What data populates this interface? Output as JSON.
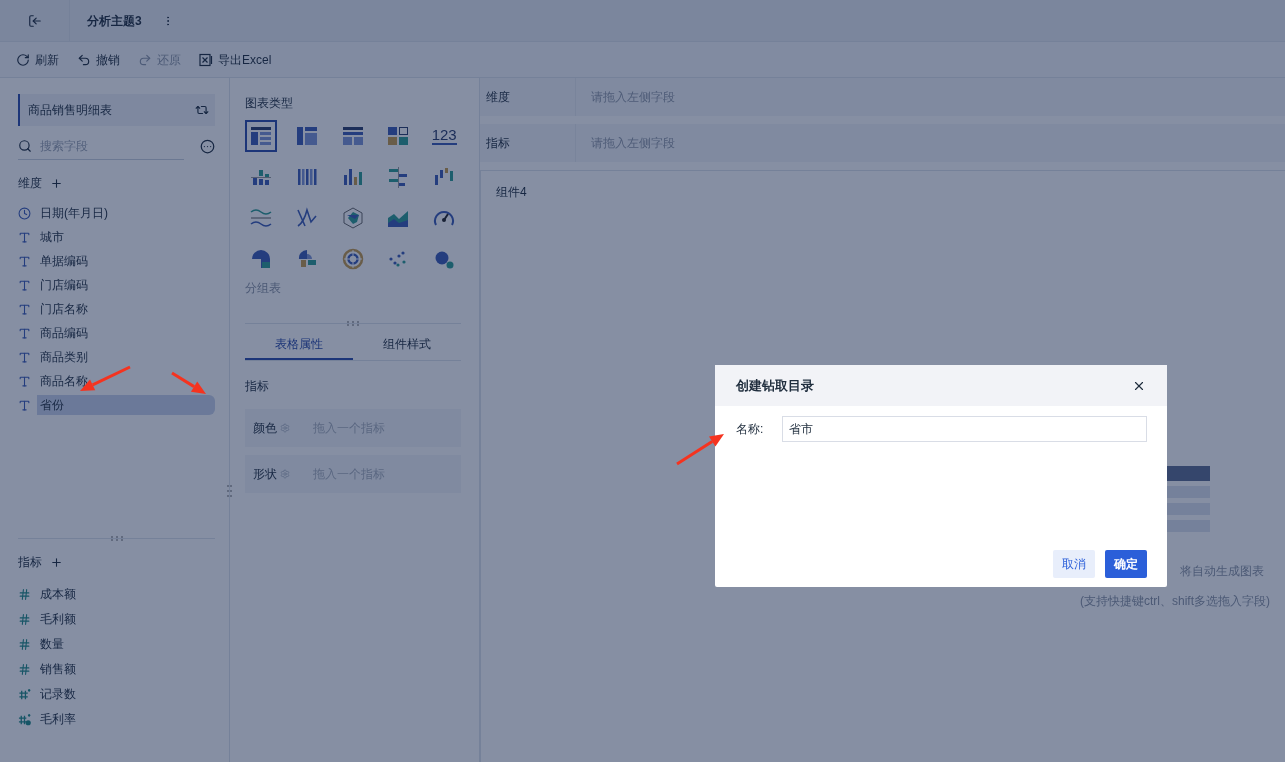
{
  "top_bar": {
    "title": "分析主题3"
  },
  "toolbar": [
    {
      "label": "刷新",
      "kind": "refresh",
      "disabled": false
    },
    {
      "label": "撤销",
      "kind": "undo",
      "disabled": false
    },
    {
      "label": "还原",
      "kind": "redo",
      "disabled": true
    },
    {
      "label": "导出Excel",
      "kind": "excel",
      "disabled": false
    }
  ],
  "dataset": {
    "name": "商品销售明细表"
  },
  "search": {
    "placeholder": "搜索字段"
  },
  "dimensions": {
    "title": "维度",
    "items": [
      {
        "label": "日期(年月日)",
        "kind": "date",
        "selected": false
      },
      {
        "label": "城市",
        "kind": "text",
        "selected": false
      },
      {
        "label": "单据编码",
        "kind": "text",
        "selected": false
      },
      {
        "label": "门店编码",
        "kind": "text",
        "selected": false
      },
      {
        "label": "门店名称",
        "kind": "text",
        "selected": false
      },
      {
        "label": "商品编码",
        "kind": "text",
        "selected": false
      },
      {
        "label": "商品类别",
        "kind": "text",
        "selected": false
      },
      {
        "label": "商品名称",
        "kind": "text",
        "selected": false
      },
      {
        "label": "省份",
        "kind": "text",
        "selected": true
      }
    ]
  },
  "measures": {
    "title": "指标",
    "items": [
      {
        "label": "成本额",
        "kind": "number"
      },
      {
        "label": "毛利额",
        "kind": "number"
      },
      {
        "label": "数量",
        "kind": "number"
      },
      {
        "label": "销售额",
        "kind": "number"
      },
      {
        "label": "记录数",
        "kind": "count"
      },
      {
        "label": "毛利率",
        "kind": "calculated"
      }
    ]
  },
  "chart_panel": {
    "title": "图表类型",
    "chart_types": [
      {
        "kind": "table",
        "selected": true
      },
      {
        "kind": "cross",
        "selected": false
      },
      {
        "kind": "group",
        "selected": false
      },
      {
        "kind": "blocks",
        "selected": false
      },
      {
        "kind": "number",
        "label": "123",
        "selected": false
      },
      {
        "kind": "stacked",
        "selected": false
      },
      {
        "kind": "multibar",
        "selected": false
      },
      {
        "kind": "bar",
        "selected": false
      },
      {
        "kind": "hbar",
        "selected": false
      },
      {
        "kind": "waterfall",
        "selected": false
      },
      {
        "kind": "wave",
        "selected": false
      },
      {
        "kind": "line",
        "selected": false
      },
      {
        "kind": "radar",
        "selected": false
      },
      {
        "kind": "area",
        "selected": false
      },
      {
        "kind": "gauge",
        "selected": false
      },
      {
        "kind": "pie",
        "selected": false
      },
      {
        "kind": "rose",
        "selected": false
      },
      {
        "kind": "sunburst",
        "selected": false
      },
      {
        "kind": "scatter",
        "selected": false
      },
      {
        "kind": "bubble",
        "selected": false
      }
    ],
    "selected_name": "分组表",
    "tabs": [
      {
        "label": "表格属性",
        "selected": true
      },
      {
        "label": "组件样式",
        "selected": false
      }
    ],
    "section_title": "指标",
    "slots": [
      {
        "label": "颜色",
        "placeholder": "拖入一个指标"
      },
      {
        "label": "形状",
        "placeholder": "拖入一个指标"
      }
    ]
  },
  "shelves": [
    {
      "label": "维度",
      "placeholder": "请拖入左侧字段"
    },
    {
      "label": "指标",
      "placeholder": "请拖入左侧字段"
    }
  ],
  "canvas": {
    "title": "组件4",
    "hint": "将自动生成图表",
    "hint_2": "(支持快捷键ctrl、shift多选拖入字段)"
  },
  "dialog": {
    "title": "创建钻取目录",
    "field_label": "名称:",
    "value": "省市",
    "buttons": [
      {
        "label": "取消",
        "kind": "secondary"
      },
      {
        "label": "确定",
        "kind": "primary"
      }
    ]
  }
}
